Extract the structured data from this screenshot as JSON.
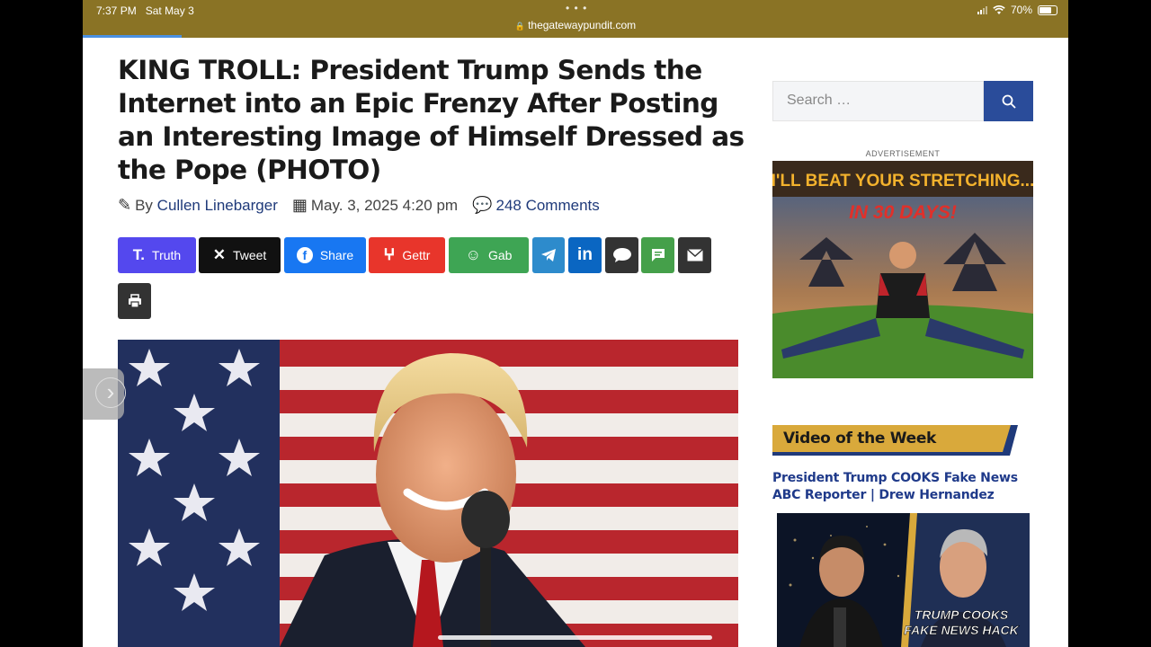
{
  "status": {
    "time": "7:37 PM",
    "date": "Sat May 3",
    "url": "thegatewaypundit.com",
    "battery": "70%",
    "battery_level": 0.7
  },
  "article": {
    "headline": "KING TROLL: President Trump Sends the Internet into an Epic Frenzy After Posting an Interesting Image of Himself Dressed as the Pope (PHOTO)",
    "by": "By",
    "author": "Cullen Linebarger",
    "date": "May. 3, 2025 4:20 pm",
    "comments": "248 Comments"
  },
  "share_buttons": [
    {
      "label": "Truth",
      "icon": "truth-social-icon",
      "color": "#5448ee"
    },
    {
      "label": "Tweet",
      "icon": "x-icon",
      "color": "#111111"
    },
    {
      "label": "Share",
      "icon": "facebook-icon",
      "color": "#1877f2"
    },
    {
      "label": "Gettr",
      "icon": "gettr-icon",
      "color": "#e8352b"
    },
    {
      "label": "Gab",
      "icon": "gab-icon",
      "color": "#3ea554"
    },
    {
      "label": "",
      "icon": "telegram-icon",
      "color": "#2d8bcc"
    },
    {
      "label": "",
      "icon": "linkedin-icon",
      "color": "#0a66c2"
    },
    {
      "label": "",
      "icon": "comment-icon",
      "color": "#333333"
    },
    {
      "label": "",
      "icon": "sms-icon",
      "color": "#45a04a"
    },
    {
      "label": "",
      "icon": "email-icon",
      "color": "#333333"
    },
    {
      "label": "",
      "icon": "print-icon",
      "color": "#333333"
    }
  ],
  "sidebar": {
    "search_placeholder": "Search …",
    "ad_label": "ADVERTISEMENT",
    "ad_headline_1": "I'LL BEAT YOUR STRETCHING...",
    "ad_headline_2": "IN 30 DAYS!",
    "video_section": "Video of the Week",
    "video_title": "President Trump COOKS Fake News ABC Reporter | Drew Hernandez",
    "thumb_text_1": "TRUMP COOKS",
    "thumb_text_2": "FAKE NEWS HACK"
  },
  "colors": {
    "status_bar": "#8a7325",
    "accent_gold": "#d9a93b",
    "accent_blue": "#2a4c9a",
    "link": "#1f3a7a"
  }
}
